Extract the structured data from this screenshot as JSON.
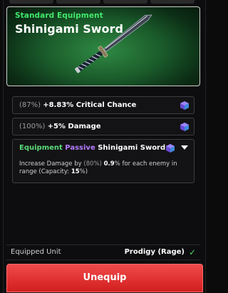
{
  "header": {
    "category": "Standard Equipment",
    "item_name": "Shinigami Sword"
  },
  "stats": [
    {
      "percent": "(87%)",
      "value": "+8.83% Critical Chance",
      "icon": "gem-icon"
    },
    {
      "percent": "(100%)",
      "value": "+5% Damage",
      "icon": "gem-icon"
    }
  ],
  "passive": {
    "label_equipment": "Equipment",
    "label_passive": "Passive",
    "name": "Shinigami Sword",
    "desc_1": "Increase Damage by",
    "desc_pct": "(80%)",
    "desc_val": "0.9",
    "desc_2": "% for each enemy in range (Capacity:",
    "desc_cap": "15",
    "desc_3": "%)"
  },
  "equipped": {
    "label": "Equipped Unit",
    "unit": "Prodigy (Rage)"
  },
  "button": {
    "label": "Unequip"
  },
  "colors": {
    "accent_green": "#42e86b",
    "passive_purple": "#b57cff",
    "button_red": "#e33535",
    "check_green": "#4ed36a"
  }
}
